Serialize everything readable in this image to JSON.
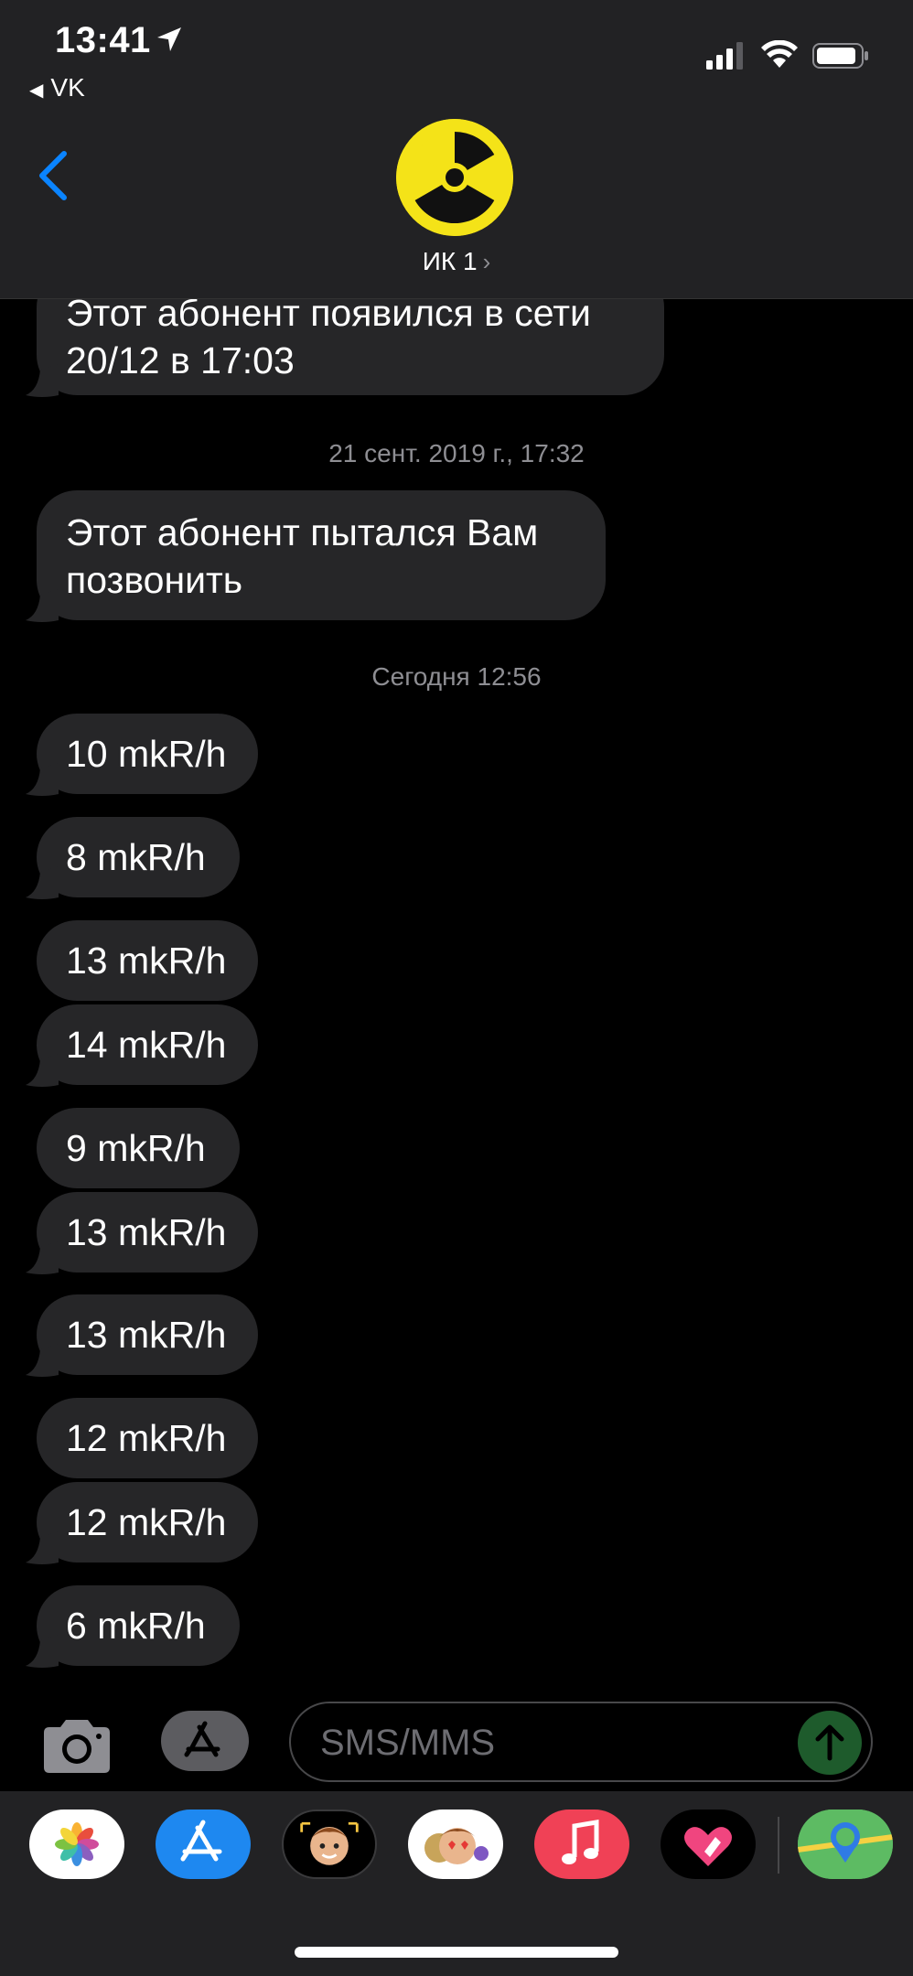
{
  "status_bar": {
    "time": "13:41",
    "back_app": "VK"
  },
  "header": {
    "contact_name": "ИК 1"
  },
  "messages_top": [
    {
      "text": "Этот абонент появился в сети 20/12 в 17:03"
    }
  ],
  "timestamps": [
    "21 сент. 2019 г., 17:32",
    "Сегодня 12:56"
  ],
  "message_call": "Этот абонент пытался Вам позвонить",
  "readings": [
    "10 mkR/h",
    "8 mkR/h",
    "13 mkR/h",
    "14 mkR/h",
    "9 mkR/h",
    "13 mkR/h",
    "13 mkR/h",
    "12 mkR/h",
    "12 mkR/h",
    "6 mkR/h"
  ],
  "input": {
    "placeholder": "SMS/MMS"
  },
  "drawer_apps": [
    {
      "name": "photos-icon"
    },
    {
      "name": "app-store-icon"
    },
    {
      "name": "memoji-icon"
    },
    {
      "name": "animoji-stickers-icon"
    },
    {
      "name": "music-icon"
    },
    {
      "name": "digital-touch-icon"
    },
    {
      "name": "maps-icon"
    }
  ],
  "colors": {
    "bubble": "#262628",
    "background": "#000000",
    "header": "#222224",
    "accent_blue": "#0A84FF",
    "avatar_yellow": "#F4E318"
  }
}
